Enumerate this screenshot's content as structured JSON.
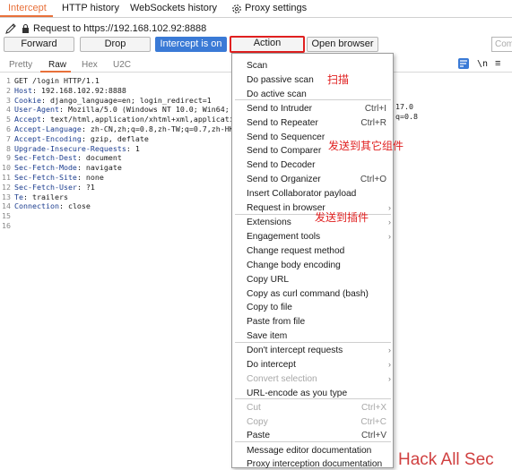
{
  "tabs": [
    "Intercept",
    "HTTP history",
    "WebSockets history",
    "Proxy settings"
  ],
  "request_line": "Request to https://192.168.102.92:8888",
  "buttons": {
    "forward": "Forward",
    "drop": "Drop",
    "intercept": "Intercept is on",
    "action": "Action",
    "open_browser": "Open browser",
    "comment_placeholder": "Com"
  },
  "editor_tabs": [
    "Pretty",
    "Raw",
    "Hex",
    "U2C"
  ],
  "editor_tools": {
    "newline_toggle": "\\n",
    "menu_glyph": "≡"
  },
  "request_lines": [
    {
      "n": "1",
      "key": "",
      "text": "GET /login HTTP/1.1"
    },
    {
      "n": "2",
      "key": "Host",
      "text": ": 192.168.102.92:8888"
    },
    {
      "n": "3",
      "key": "Cookie",
      "text": ": django_language=en; login_redirect=1"
    },
    {
      "n": "4",
      "key": "User-Agent",
      "text": ": Mozilla/5.0 (Windows NT 10.0; Win64; x"
    },
    {
      "n": "5",
      "key": "Accept",
      "text": ": text/html,application/xhtml+xml,applicatio"
    },
    {
      "n": "6",
      "key": "Accept-Language",
      "text": ": zh-CN,zh;q=0.8,zh-TW;q=0.7,zh-HK;"
    },
    {
      "n": "7",
      "key": "Accept-Encoding",
      "text": ": gzip, deflate"
    },
    {
      "n": "8",
      "key": "Upgrade-Insecure-Requests",
      "text": ": 1"
    },
    {
      "n": "9",
      "key": "Sec-Fetch-Dest",
      "text": ": document"
    },
    {
      "n": "10",
      "key": "Sec-Fetch-Mode",
      "text": ": navigate"
    },
    {
      "n": "11",
      "key": "Sec-Fetch-Site",
      "text": ": none"
    },
    {
      "n": "12",
      "key": "Sec-Fetch-User",
      "text": ": ?1"
    },
    {
      "n": "13",
      "key": "Te",
      "text": ": trailers"
    },
    {
      "n": "14",
      "key": "Connection",
      "text": ": close"
    },
    {
      "n": "15",
      "key": "",
      "text": ""
    },
    {
      "n": "16",
      "key": "",
      "text": ""
    }
  ],
  "clipped_right": {
    "line4": "17.0",
    "line5": "q=0.8"
  },
  "menu_items": [
    {
      "label": "Scan",
      "shortcut": "",
      "submenu": false,
      "disabled": false
    },
    {
      "label": "Do passive scan",
      "shortcut": "",
      "submenu": false,
      "disabled": false
    },
    {
      "label": "Do active scan",
      "shortcut": "",
      "submenu": false,
      "disabled": false
    },
    {
      "label": "Send to Intruder",
      "shortcut": "Ctrl+I",
      "submenu": false,
      "disabled": false
    },
    {
      "label": "Send to Repeater",
      "shortcut": "Ctrl+R",
      "submenu": false,
      "disabled": false
    },
    {
      "label": "Send to Sequencer",
      "shortcut": "",
      "submenu": false,
      "disabled": false
    },
    {
      "label": "Send to Comparer",
      "shortcut": "",
      "submenu": false,
      "disabled": false
    },
    {
      "label": "Send to Decoder",
      "shortcut": "",
      "submenu": false,
      "disabled": false
    },
    {
      "label": "Send to Organizer",
      "shortcut": "Ctrl+O",
      "submenu": false,
      "disabled": false
    },
    {
      "label": "Insert Collaborator payload",
      "shortcut": "",
      "submenu": false,
      "disabled": false
    },
    {
      "label": "Request in browser",
      "shortcut": "",
      "submenu": true,
      "disabled": false
    },
    {
      "label": "Extensions",
      "shortcut": "",
      "submenu": true,
      "disabled": false
    },
    {
      "label": "Engagement tools",
      "shortcut": "",
      "submenu": true,
      "disabled": false
    },
    {
      "label": "Change request method",
      "shortcut": "",
      "submenu": false,
      "disabled": false
    },
    {
      "label": "Change body encoding",
      "shortcut": "",
      "submenu": false,
      "disabled": false
    },
    {
      "label": "Copy URL",
      "shortcut": "",
      "submenu": false,
      "disabled": false
    },
    {
      "label": "Copy as curl command (bash)",
      "shortcut": "",
      "submenu": false,
      "disabled": false
    },
    {
      "label": "Copy to file",
      "shortcut": "",
      "submenu": false,
      "disabled": false
    },
    {
      "label": "Paste from file",
      "shortcut": "",
      "submenu": false,
      "disabled": false
    },
    {
      "label": "Save item",
      "shortcut": "",
      "submenu": false,
      "disabled": false
    },
    {
      "label": "Don't intercept requests",
      "shortcut": "",
      "submenu": true,
      "disabled": false
    },
    {
      "label": "Do intercept",
      "shortcut": "",
      "submenu": true,
      "disabled": false
    },
    {
      "label": "Convert selection",
      "shortcut": "",
      "submenu": true,
      "disabled": true
    },
    {
      "label": "URL-encode as you type",
      "shortcut": "",
      "submenu": false,
      "disabled": false
    },
    {
      "label": "Cut",
      "shortcut": "Ctrl+X",
      "submenu": false,
      "disabled": true
    },
    {
      "label": "Copy",
      "shortcut": "Ctrl+C",
      "submenu": false,
      "disabled": true
    },
    {
      "label": "Paste",
      "shortcut": "Ctrl+V",
      "submenu": false,
      "disabled": false
    },
    {
      "label": "Message editor documentation",
      "shortcut": "",
      "submenu": false,
      "disabled": false
    },
    {
      "label": "Proxy interception documentation",
      "shortcut": "",
      "submenu": false,
      "disabled": false
    }
  ],
  "annotations": {
    "scan": "扫描",
    "send_to": "发送到其它组件",
    "extensions": "发送到插件"
  },
  "watermark": "Hack All Sec",
  "colors": {
    "accent": "#e8703a",
    "primary_button": "#3a7ad6",
    "highlight_red": "#e02020"
  }
}
